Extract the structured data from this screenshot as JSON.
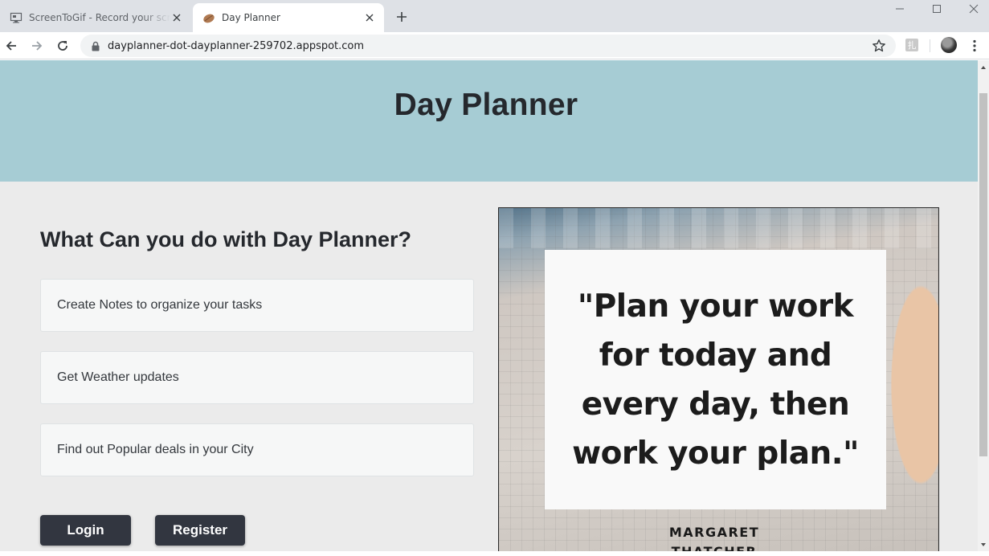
{
  "browser": {
    "tabs": [
      {
        "title": "ScreenToGif - Record your screen",
        "active": false,
        "icon": "monitor-icon"
      },
      {
        "title": "Day Planner",
        "active": true,
        "icon": "leaf-icon"
      }
    ],
    "url": "dayplanner-dot-dayplanner-259702.appspot.com",
    "extension_label": "扎"
  },
  "page": {
    "header_title": "Day Planner",
    "section_title": "What Can you do with Day Planner?",
    "features": [
      "Create Notes to organize your tasks",
      "Get Weather updates",
      "Find out Popular deals in your City"
    ],
    "buttons": {
      "login": "Login",
      "register": "Register"
    },
    "quote": {
      "lines": [
        "\"Plan your work",
        "for today and",
        "every day, then",
        "work your plan.\""
      ],
      "author_lines": [
        "MARGARET",
        "THATCHER"
      ]
    }
  },
  "colors": {
    "hero_bg": "#a6ccd4",
    "page_bg": "#ebebeb",
    "button_bg": "#323640",
    "text_dark": "#25282d"
  }
}
